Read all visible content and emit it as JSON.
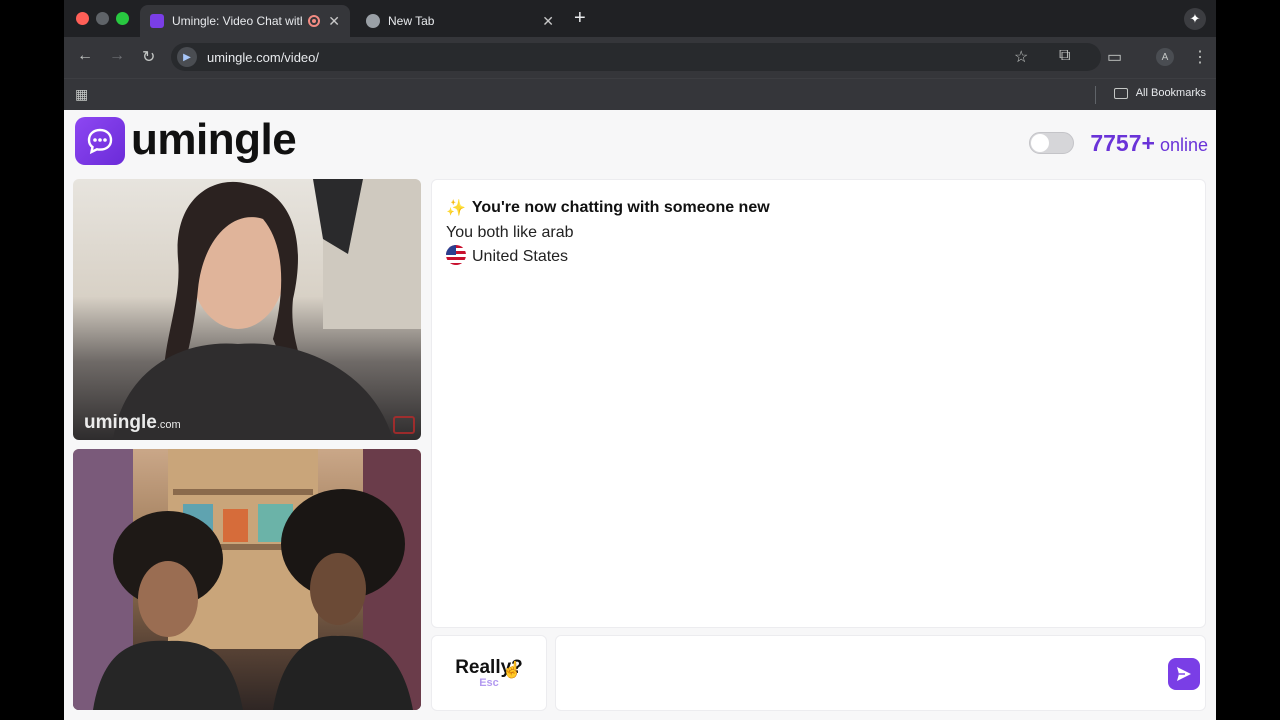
{
  "browser": {
    "tabs": [
      {
        "title": "Umingle: Video Chat with",
        "active": true
      },
      {
        "title": "New Tab",
        "active": false
      }
    ],
    "url": "umingle.com/video/",
    "bookmarks_label": "All Bookmarks",
    "profile_initial": "A"
  },
  "header": {
    "brand": "umingle",
    "online_count": "7757+",
    "online_label": "online"
  },
  "videos": {
    "watermark_brand": "umingle",
    "watermark_suffix": ".com"
  },
  "chat": {
    "title": "You're now chatting with someone new",
    "common_interest": "You both like arab",
    "country": "United States"
  },
  "controls": {
    "skip_label": "Really?",
    "skip_key": "Esc",
    "message_placeholder": ""
  },
  "colors": {
    "brand": "#7a3ee6",
    "online": "#6a33d8"
  }
}
